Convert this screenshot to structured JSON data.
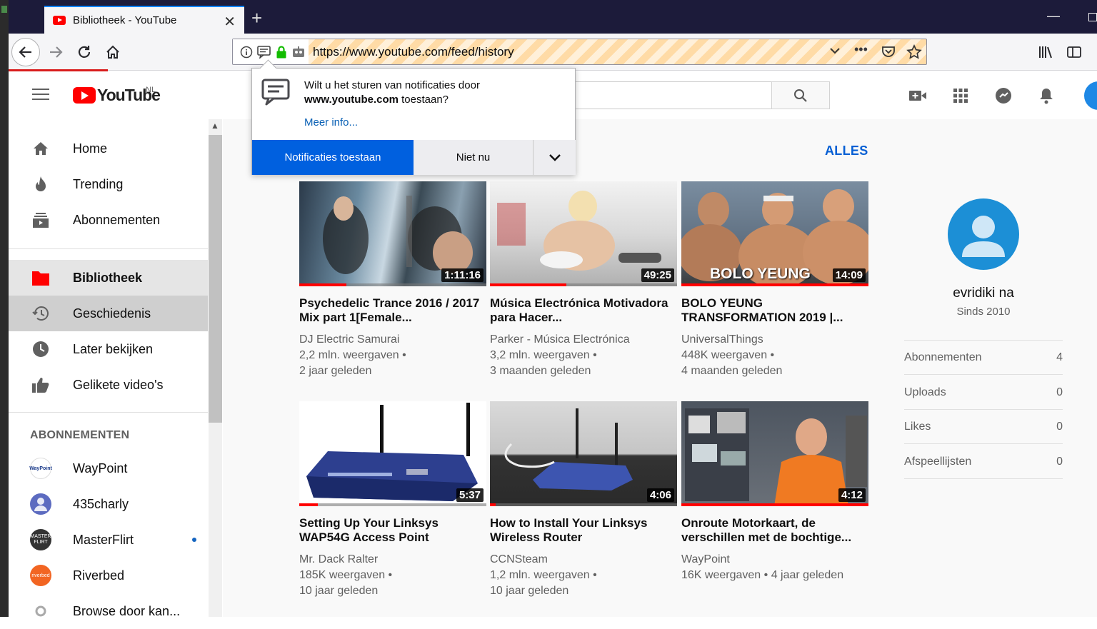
{
  "browser": {
    "tab_title": "Bibliotheek - YouTube",
    "url": "https://www.youtube.com/feed/history"
  },
  "youtube": {
    "logo_text": "YouTube",
    "country_code": "NL"
  },
  "sidebar": {
    "items": [
      {
        "label": "Home",
        "icon": "home-icon"
      },
      {
        "label": "Trending",
        "icon": "trending-icon"
      },
      {
        "label": "Abonnementen",
        "icon": "subscriptions-icon"
      },
      {
        "label": "Bibliotheek",
        "icon": "library-icon"
      },
      {
        "label": "Geschiedenis",
        "icon": "history-icon"
      },
      {
        "label": "Later bekijken",
        "icon": "watch-later-icon"
      },
      {
        "label": "Gelikete video's",
        "icon": "liked-videos-icon"
      }
    ],
    "subscriptions_heading": "ABONNEMENTEN",
    "subscriptions": [
      {
        "label": "WayPoint",
        "avatar_text": "WayPoint"
      },
      {
        "label": "435charly"
      },
      {
        "label": "MasterFlirt",
        "avatar_text": "MASTER FLIRT"
      },
      {
        "label": "Riverbed",
        "avatar_text": "riverbed"
      },
      {
        "label": "Browse door kan..."
      }
    ]
  },
  "main": {
    "see_all_label": "ALLES",
    "videos": [
      {
        "title": "Psychedelic Trance 2016 / 2017 Mix part 1[Female...",
        "channel": "DJ Electric Samurai",
        "views": "2,2 mln. weergaven",
        "age": "2 jaar geleden",
        "duration": "1:11:16",
        "progress": 0.25
      },
      {
        "title": "Música Electrónica Motivadora para Hacer...",
        "channel": "Parker - Música Electrónica",
        "views": "3,2 mln. weergaven",
        "age": "3 maanden geleden",
        "duration": "49:25",
        "progress": 0.41
      },
      {
        "title": "BOLO YEUNG TRANSFORMATION 2019 |...",
        "channel": "UniversalThings",
        "views": "448K weergaven",
        "age": "4 maanden geleden",
        "duration": "14:09",
        "progress": 1.0,
        "thumb_caption": "BOLO YEUNG"
      },
      {
        "title": "Setting Up Your Linksys WAP54G Access Point",
        "channel": "Mr. Dack Ralter",
        "views": "185K weergaven",
        "age": "10 jaar geleden",
        "duration": "5:37",
        "progress": 0.1
      },
      {
        "title": "How to Install Your Linksys Wireless Router",
        "channel": "CCNSteam",
        "views": "1,2 mln. weergaven",
        "age": "10 jaar geleden",
        "duration": "4:06",
        "progress": 0.03
      },
      {
        "title": "Onroute Motorkaart, de verschillen met de bochtige...",
        "channel": "WayPoint",
        "views": "16K weergaven",
        "age": "4 jaar geleden",
        "duration": "4:12",
        "progress": 1.0
      }
    ]
  },
  "profile": {
    "name": "evridiki na",
    "since": "Sinds 2010",
    "stats": [
      {
        "label": "Abonnementen",
        "value": "4"
      },
      {
        "label": "Uploads",
        "value": "0"
      },
      {
        "label": "Likes",
        "value": "0"
      },
      {
        "label": "Afspeellijsten",
        "value": "0"
      }
    ]
  },
  "notification": {
    "question_prefix": "Wilt u het sturen van notificaties door",
    "site": "www.youtube.com",
    "question_suffix": "toestaan?",
    "more_info": "Meer info...",
    "allow_label": "Notificaties toestaan",
    "deny_label": "Niet nu"
  }
}
